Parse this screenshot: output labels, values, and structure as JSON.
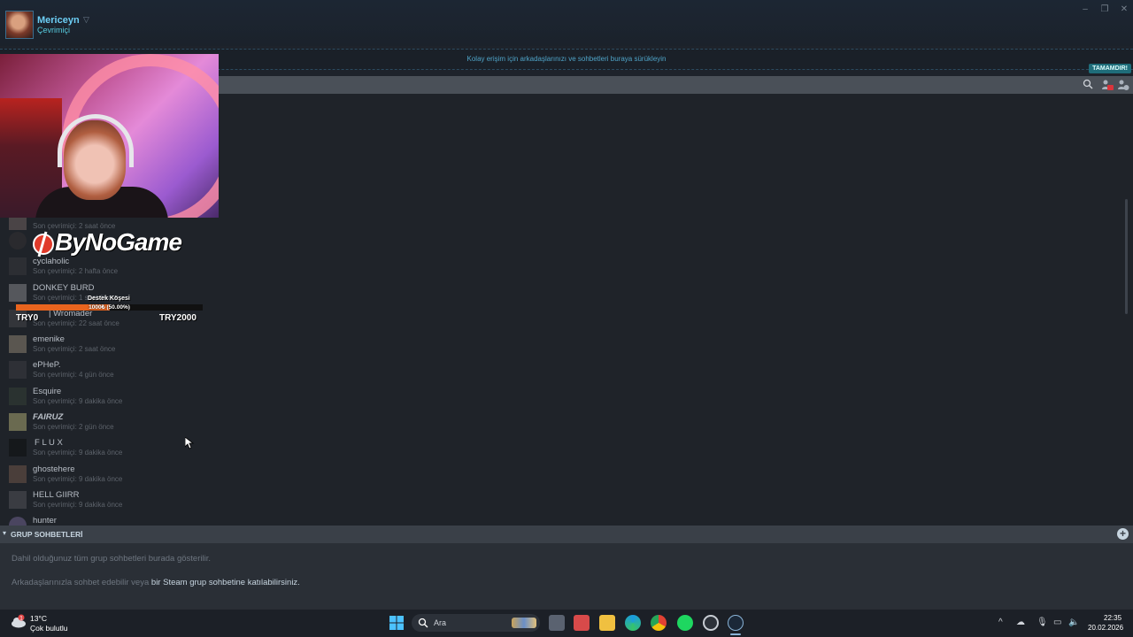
{
  "header": {
    "user_name": "Mericeyn",
    "user_status": "Çevrimiçi",
    "window_controls": [
      "minimize-icon",
      "restore-icon",
      "close-icon"
    ]
  },
  "favorites": {
    "drop_hint": "Kolay erişim için arkadaşlarınızı ve sohbetleri buraya sürükleyin",
    "done_label": "TAMAMDIR!"
  },
  "friends": [
    {
      "name": "",
      "status": "Son çevrimiçi: 2 saat önce"
    },
    {
      "name": "",
      "status": ""
    },
    {
      "name": "cyclaholic",
      "status": "Son çevrimiçi: 2 hafta önce"
    },
    {
      "name": "DONKEY BURD",
      "status": "Son çevrimiçi: 1 saat önce"
    },
    {
      "name": "| Wromader",
      "status": "Son çevrimiçi: 22 saat önce"
    },
    {
      "name": "emenike",
      "status": "Son çevrimiçi: 2 saat önce"
    },
    {
      "name": "ePHeP.",
      "status": "Son çevrimiçi: 4 gün önce"
    },
    {
      "name": "Esquire",
      "status": "Son çevrimiçi: 9 dakika önce"
    },
    {
      "name": "FAIRUZ",
      "status": "Son çevrimiçi: 2 gün önce"
    },
    {
      "name": "F L U X",
      "status": "Son çevrimiçi: 9 dakika önce"
    },
    {
      "name": "ghostehere",
      "status": "Son çevrimiçi: 9 dakika önce"
    },
    {
      "name": "HELL GIIRR",
      "status": "Son çevrimiçi: 9 dakika önce"
    },
    {
      "name": "hunter",
      "status": ""
    }
  ],
  "overlay": {
    "brand": "ByNoGame",
    "destek_label": "Destek Köşesi",
    "progress_text": "1000₺ (50.00%)",
    "progress_fraction": 0.5,
    "min_label": "TRY0",
    "max_label": "TRY2000"
  },
  "group_chats": {
    "title": "GRUP SOHBETLERİ",
    "line1": "Dahil olduğunuz tüm grup sohbetleri burada gösterilir.",
    "line2_prefix": "Arkadaşlarınızla sohbet edebilir veya ",
    "line2_link": "bir Steam grup sohbetine katılabilirsiniz."
  },
  "taskbar": {
    "temperature": "13°C",
    "weather": "Çok bulutlu",
    "weather_badge": "1",
    "search_label": "Ara",
    "time": "22:35",
    "date": "20.02.2026"
  },
  "colors": {
    "accent": "#6dcff6",
    "progress": "#e8641e",
    "background": "#1f2329"
  }
}
